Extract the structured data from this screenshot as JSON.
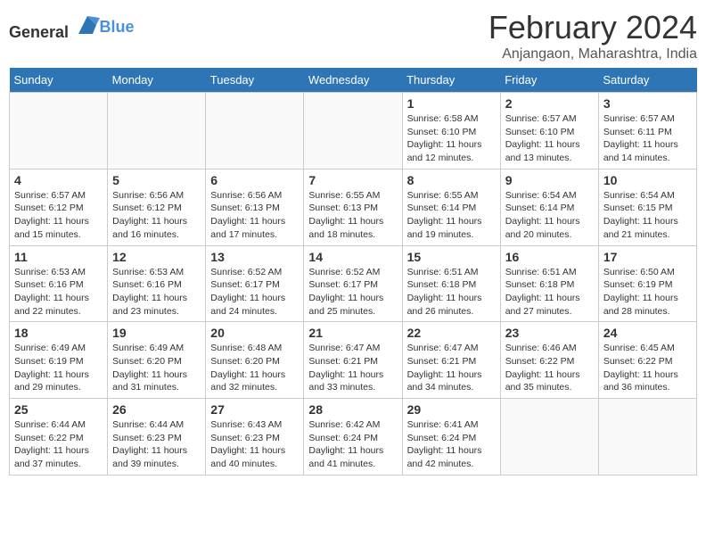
{
  "header": {
    "logo_general": "General",
    "logo_blue": "Blue",
    "month_year": "February 2024",
    "location": "Anjangaon, Maharashtra, India"
  },
  "weekdays": [
    "Sunday",
    "Monday",
    "Tuesday",
    "Wednesday",
    "Thursday",
    "Friday",
    "Saturday"
  ],
  "weeks": [
    [
      {
        "day": "",
        "info": ""
      },
      {
        "day": "",
        "info": ""
      },
      {
        "day": "",
        "info": ""
      },
      {
        "day": "",
        "info": ""
      },
      {
        "day": "1",
        "info": "Sunrise: 6:58 AM\nSunset: 6:10 PM\nDaylight: 11 hours\nand 12 minutes."
      },
      {
        "day": "2",
        "info": "Sunrise: 6:57 AM\nSunset: 6:10 PM\nDaylight: 11 hours\nand 13 minutes."
      },
      {
        "day": "3",
        "info": "Sunrise: 6:57 AM\nSunset: 6:11 PM\nDaylight: 11 hours\nand 14 minutes."
      }
    ],
    [
      {
        "day": "4",
        "info": "Sunrise: 6:57 AM\nSunset: 6:12 PM\nDaylight: 11 hours\nand 15 minutes."
      },
      {
        "day": "5",
        "info": "Sunrise: 6:56 AM\nSunset: 6:12 PM\nDaylight: 11 hours\nand 16 minutes."
      },
      {
        "day": "6",
        "info": "Sunrise: 6:56 AM\nSunset: 6:13 PM\nDaylight: 11 hours\nand 17 minutes."
      },
      {
        "day": "7",
        "info": "Sunrise: 6:55 AM\nSunset: 6:13 PM\nDaylight: 11 hours\nand 18 minutes."
      },
      {
        "day": "8",
        "info": "Sunrise: 6:55 AM\nSunset: 6:14 PM\nDaylight: 11 hours\nand 19 minutes."
      },
      {
        "day": "9",
        "info": "Sunrise: 6:54 AM\nSunset: 6:14 PM\nDaylight: 11 hours\nand 20 minutes."
      },
      {
        "day": "10",
        "info": "Sunrise: 6:54 AM\nSunset: 6:15 PM\nDaylight: 11 hours\nand 21 minutes."
      }
    ],
    [
      {
        "day": "11",
        "info": "Sunrise: 6:53 AM\nSunset: 6:16 PM\nDaylight: 11 hours\nand 22 minutes."
      },
      {
        "day": "12",
        "info": "Sunrise: 6:53 AM\nSunset: 6:16 PM\nDaylight: 11 hours\nand 23 minutes."
      },
      {
        "day": "13",
        "info": "Sunrise: 6:52 AM\nSunset: 6:17 PM\nDaylight: 11 hours\nand 24 minutes."
      },
      {
        "day": "14",
        "info": "Sunrise: 6:52 AM\nSunset: 6:17 PM\nDaylight: 11 hours\nand 25 minutes."
      },
      {
        "day": "15",
        "info": "Sunrise: 6:51 AM\nSunset: 6:18 PM\nDaylight: 11 hours\nand 26 minutes."
      },
      {
        "day": "16",
        "info": "Sunrise: 6:51 AM\nSunset: 6:18 PM\nDaylight: 11 hours\nand 27 minutes."
      },
      {
        "day": "17",
        "info": "Sunrise: 6:50 AM\nSunset: 6:19 PM\nDaylight: 11 hours\nand 28 minutes."
      }
    ],
    [
      {
        "day": "18",
        "info": "Sunrise: 6:49 AM\nSunset: 6:19 PM\nDaylight: 11 hours\nand 29 minutes."
      },
      {
        "day": "19",
        "info": "Sunrise: 6:49 AM\nSunset: 6:20 PM\nDaylight: 11 hours\nand 31 minutes."
      },
      {
        "day": "20",
        "info": "Sunrise: 6:48 AM\nSunset: 6:20 PM\nDaylight: 11 hours\nand 32 minutes."
      },
      {
        "day": "21",
        "info": "Sunrise: 6:47 AM\nSunset: 6:21 PM\nDaylight: 11 hours\nand 33 minutes."
      },
      {
        "day": "22",
        "info": "Sunrise: 6:47 AM\nSunset: 6:21 PM\nDaylight: 11 hours\nand 34 minutes."
      },
      {
        "day": "23",
        "info": "Sunrise: 6:46 AM\nSunset: 6:22 PM\nDaylight: 11 hours\nand 35 minutes."
      },
      {
        "day": "24",
        "info": "Sunrise: 6:45 AM\nSunset: 6:22 PM\nDaylight: 11 hours\nand 36 minutes."
      }
    ],
    [
      {
        "day": "25",
        "info": "Sunrise: 6:44 AM\nSunset: 6:22 PM\nDaylight: 11 hours\nand 37 minutes."
      },
      {
        "day": "26",
        "info": "Sunrise: 6:44 AM\nSunset: 6:23 PM\nDaylight: 11 hours\nand 39 minutes."
      },
      {
        "day": "27",
        "info": "Sunrise: 6:43 AM\nSunset: 6:23 PM\nDaylight: 11 hours\nand 40 minutes."
      },
      {
        "day": "28",
        "info": "Sunrise: 6:42 AM\nSunset: 6:24 PM\nDaylight: 11 hours\nand 41 minutes."
      },
      {
        "day": "29",
        "info": "Sunrise: 6:41 AM\nSunset: 6:24 PM\nDaylight: 11 hours\nand 42 minutes."
      },
      {
        "day": "",
        "info": ""
      },
      {
        "day": "",
        "info": ""
      }
    ]
  ]
}
